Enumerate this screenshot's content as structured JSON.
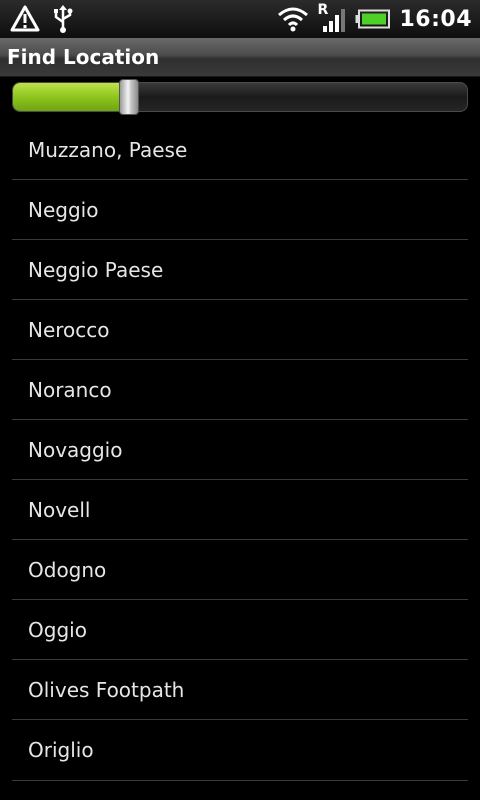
{
  "status_bar": {
    "time": "16:04",
    "roaming_label": "R",
    "icons": [
      "warning-icon",
      "usb-icon",
      "wifi-icon",
      "signal-icon",
      "battery-icon"
    ]
  },
  "title": "Find Location",
  "progress": {
    "fraction": 0.24,
    "fill_color": "#8fc51d"
  },
  "locations": [
    "Muzzano, Paese",
    "Neggio",
    "Neggio Paese",
    "Nerocco",
    "Noranco",
    "Novaggio",
    "Novell",
    "Odogno",
    "Oggio",
    "Olives Footpath",
    "Origlio"
  ]
}
